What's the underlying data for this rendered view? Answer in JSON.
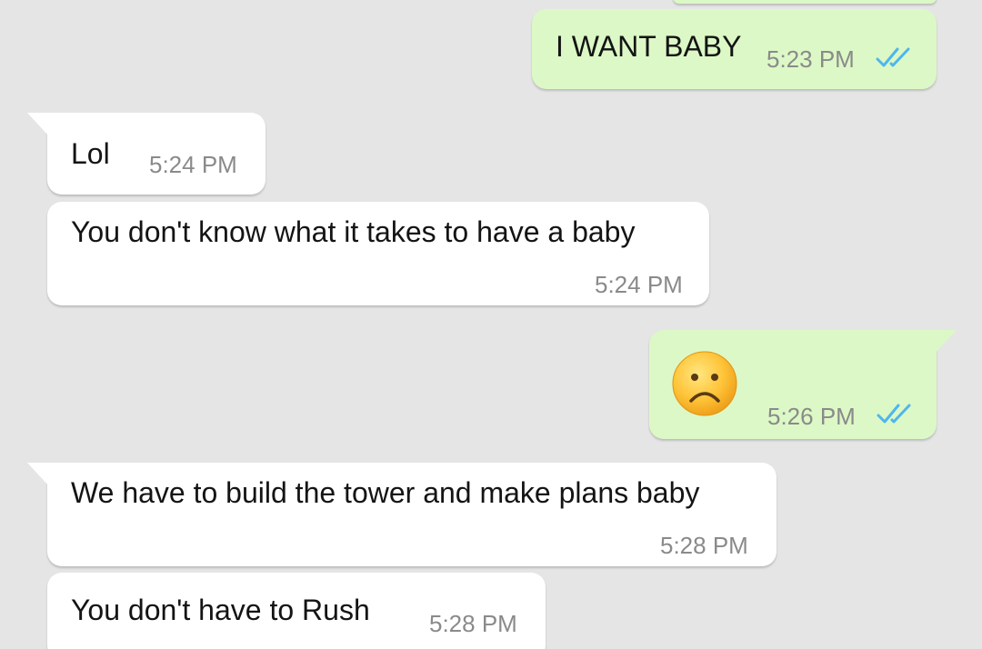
{
  "conversation": {
    "messages": [
      {
        "direction": "outgoing",
        "text": "I WANT BABY",
        "time": "5:23 PM",
        "status": "read"
      },
      {
        "direction": "incoming",
        "text": "Lol",
        "time": "5:24 PM"
      },
      {
        "direction": "incoming",
        "text": "You don't know what it takes to have a baby",
        "time": "5:24 PM"
      },
      {
        "direction": "outgoing",
        "emoji": "frowning-face-icon",
        "time": "5:26 PM",
        "status": "read"
      },
      {
        "direction": "incoming",
        "text": "We have to build the tower and make plans baby",
        "time": "5:28 PM"
      },
      {
        "direction": "incoming",
        "text": "You don't have to Rush",
        "time": "5:28 PM"
      }
    ]
  },
  "colors": {
    "background": "#e5e5e5",
    "incoming_bubble": "#ffffff",
    "outgoing_bubble": "#dcf8c6",
    "read_ticks": "#4fb6ec",
    "timestamp": "#8a8a8a"
  }
}
